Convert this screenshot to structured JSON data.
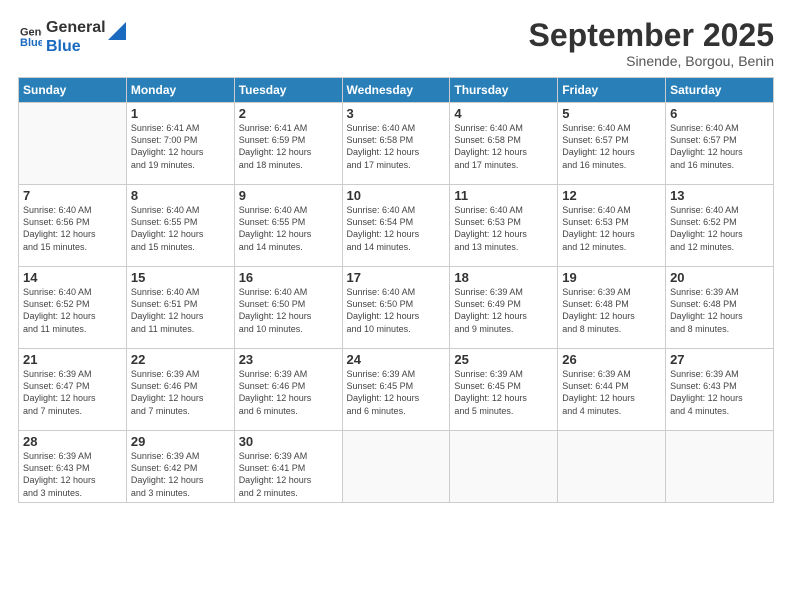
{
  "logo": {
    "line1": "General",
    "line2": "Blue"
  },
  "header": {
    "month": "September 2025",
    "location": "Sinende, Borgou, Benin"
  },
  "weekdays": [
    "Sunday",
    "Monday",
    "Tuesday",
    "Wednesday",
    "Thursday",
    "Friday",
    "Saturday"
  ],
  "weeks": [
    [
      {
        "day": "",
        "info": ""
      },
      {
        "day": "1",
        "info": "Sunrise: 6:41 AM\nSunset: 7:00 PM\nDaylight: 12 hours\nand 19 minutes."
      },
      {
        "day": "2",
        "info": "Sunrise: 6:41 AM\nSunset: 6:59 PM\nDaylight: 12 hours\nand 18 minutes."
      },
      {
        "day": "3",
        "info": "Sunrise: 6:40 AM\nSunset: 6:58 PM\nDaylight: 12 hours\nand 17 minutes."
      },
      {
        "day": "4",
        "info": "Sunrise: 6:40 AM\nSunset: 6:58 PM\nDaylight: 12 hours\nand 17 minutes."
      },
      {
        "day": "5",
        "info": "Sunrise: 6:40 AM\nSunset: 6:57 PM\nDaylight: 12 hours\nand 16 minutes."
      },
      {
        "day": "6",
        "info": "Sunrise: 6:40 AM\nSunset: 6:57 PM\nDaylight: 12 hours\nand 16 minutes."
      }
    ],
    [
      {
        "day": "7",
        "info": "Sunrise: 6:40 AM\nSunset: 6:56 PM\nDaylight: 12 hours\nand 15 minutes."
      },
      {
        "day": "8",
        "info": "Sunrise: 6:40 AM\nSunset: 6:55 PM\nDaylight: 12 hours\nand 15 minutes."
      },
      {
        "day": "9",
        "info": "Sunrise: 6:40 AM\nSunset: 6:55 PM\nDaylight: 12 hours\nand 14 minutes."
      },
      {
        "day": "10",
        "info": "Sunrise: 6:40 AM\nSunset: 6:54 PM\nDaylight: 12 hours\nand 14 minutes."
      },
      {
        "day": "11",
        "info": "Sunrise: 6:40 AM\nSunset: 6:53 PM\nDaylight: 12 hours\nand 13 minutes."
      },
      {
        "day": "12",
        "info": "Sunrise: 6:40 AM\nSunset: 6:53 PM\nDaylight: 12 hours\nand 12 minutes."
      },
      {
        "day": "13",
        "info": "Sunrise: 6:40 AM\nSunset: 6:52 PM\nDaylight: 12 hours\nand 12 minutes."
      }
    ],
    [
      {
        "day": "14",
        "info": "Sunrise: 6:40 AM\nSunset: 6:52 PM\nDaylight: 12 hours\nand 11 minutes."
      },
      {
        "day": "15",
        "info": "Sunrise: 6:40 AM\nSunset: 6:51 PM\nDaylight: 12 hours\nand 11 minutes."
      },
      {
        "day": "16",
        "info": "Sunrise: 6:40 AM\nSunset: 6:50 PM\nDaylight: 12 hours\nand 10 minutes."
      },
      {
        "day": "17",
        "info": "Sunrise: 6:40 AM\nSunset: 6:50 PM\nDaylight: 12 hours\nand 10 minutes."
      },
      {
        "day": "18",
        "info": "Sunrise: 6:39 AM\nSunset: 6:49 PM\nDaylight: 12 hours\nand 9 minutes."
      },
      {
        "day": "19",
        "info": "Sunrise: 6:39 AM\nSunset: 6:48 PM\nDaylight: 12 hours\nand 8 minutes."
      },
      {
        "day": "20",
        "info": "Sunrise: 6:39 AM\nSunset: 6:48 PM\nDaylight: 12 hours\nand 8 minutes."
      }
    ],
    [
      {
        "day": "21",
        "info": "Sunrise: 6:39 AM\nSunset: 6:47 PM\nDaylight: 12 hours\nand 7 minutes."
      },
      {
        "day": "22",
        "info": "Sunrise: 6:39 AM\nSunset: 6:46 PM\nDaylight: 12 hours\nand 7 minutes."
      },
      {
        "day": "23",
        "info": "Sunrise: 6:39 AM\nSunset: 6:46 PM\nDaylight: 12 hours\nand 6 minutes."
      },
      {
        "day": "24",
        "info": "Sunrise: 6:39 AM\nSunset: 6:45 PM\nDaylight: 12 hours\nand 6 minutes."
      },
      {
        "day": "25",
        "info": "Sunrise: 6:39 AM\nSunset: 6:45 PM\nDaylight: 12 hours\nand 5 minutes."
      },
      {
        "day": "26",
        "info": "Sunrise: 6:39 AM\nSunset: 6:44 PM\nDaylight: 12 hours\nand 4 minutes."
      },
      {
        "day": "27",
        "info": "Sunrise: 6:39 AM\nSunset: 6:43 PM\nDaylight: 12 hours\nand 4 minutes."
      }
    ],
    [
      {
        "day": "28",
        "info": "Sunrise: 6:39 AM\nSunset: 6:43 PM\nDaylight: 12 hours\nand 3 minutes."
      },
      {
        "day": "29",
        "info": "Sunrise: 6:39 AM\nSunset: 6:42 PM\nDaylight: 12 hours\nand 3 minutes."
      },
      {
        "day": "30",
        "info": "Sunrise: 6:39 AM\nSunset: 6:41 PM\nDaylight: 12 hours\nand 2 minutes."
      },
      {
        "day": "",
        "info": ""
      },
      {
        "day": "",
        "info": ""
      },
      {
        "day": "",
        "info": ""
      },
      {
        "day": "",
        "info": ""
      }
    ]
  ]
}
